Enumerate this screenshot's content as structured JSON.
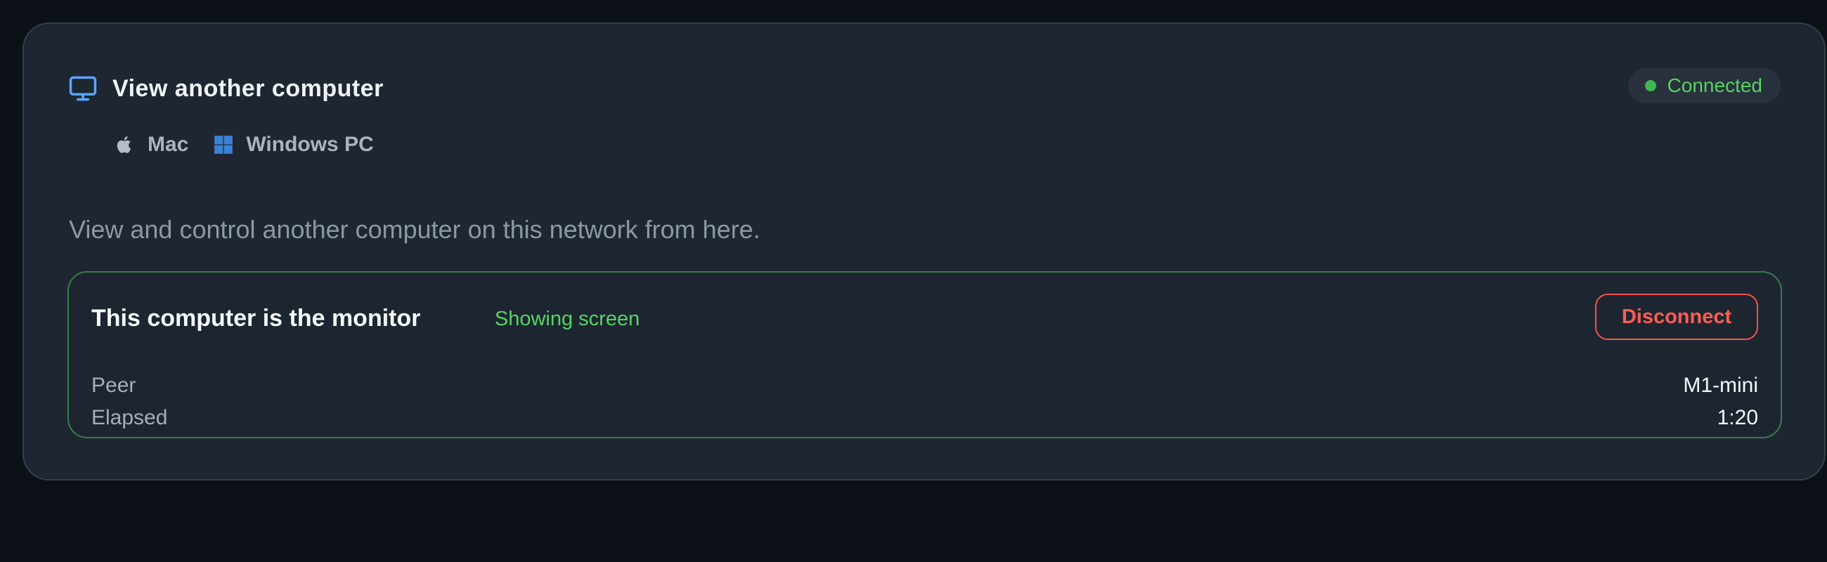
{
  "card": {
    "title": "View another computer",
    "title_icon": "monitor-icon",
    "status": {
      "label": "Connected",
      "color": "#3fb950"
    },
    "platforms": [
      {
        "label": "Mac",
        "icon": "apple-icon"
      },
      {
        "label": "Windows PC",
        "icon": "windows-icon"
      }
    ],
    "description": "View and control another computer on this network from here."
  },
  "session": {
    "title": "This computer is the monitor",
    "state": "Showing screen",
    "disconnect_label": "Disconnect",
    "details": [
      {
        "label": "Peer",
        "value": "M1-mini"
      },
      {
        "label": "Elapsed",
        "value": "1:20"
      }
    ]
  },
  "colors": {
    "accent": "#58a6ff",
    "success": "#56d364",
    "danger": "#f85149"
  }
}
